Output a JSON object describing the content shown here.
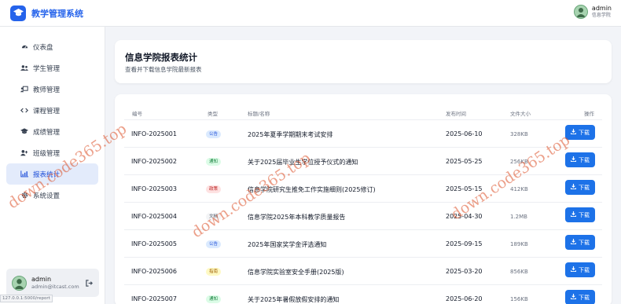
{
  "app": {
    "title": "教学管理系统"
  },
  "top_user": {
    "name": "admin",
    "role": "信息学院"
  },
  "sidebar": {
    "items": [
      {
        "label": "仪表盘",
        "icon": "dashboard-icon"
      },
      {
        "label": "学生管理",
        "icon": "users-icon"
      },
      {
        "label": "教师管理",
        "icon": "teacher-icon"
      },
      {
        "label": "课程管理",
        "icon": "code-icon"
      },
      {
        "label": "成绩管理",
        "icon": "grade-icon"
      },
      {
        "label": "班级管理",
        "icon": "class-icon"
      },
      {
        "label": "报表统计",
        "icon": "chart-icon",
        "active": true
      },
      {
        "label": "系统设置",
        "icon": "gear-icon"
      }
    ],
    "user": {
      "name": "admin",
      "email": "admin@itcast.com"
    }
  },
  "status_url": "127.0.0.1:5000/report",
  "header": {
    "title": "信息学院报表统计",
    "subtitle": "查看并下载信息学院最新报表"
  },
  "table": {
    "columns": [
      "编号",
      "类型",
      "标题/名称",
      "发布时间",
      "文件大小",
      "操作"
    ],
    "download_label": "下载",
    "rows": [
      {
        "id": "INFO-2025001",
        "type": "公告",
        "title": "2025年夏季学期期末考试安排",
        "date": "2025-06-10",
        "size": "328KB"
      },
      {
        "id": "INFO-2025002",
        "type": "通知",
        "title": "关于2025届毕业生学位授予仪式的通知",
        "date": "2025-05-25",
        "size": "256KB"
      },
      {
        "id": "INFO-2025003",
        "type": "政策",
        "title": "信息学院研究生推免工作实施细则(2025修订)",
        "date": "2025-05-15",
        "size": "412KB"
      },
      {
        "id": "INFO-2025004",
        "type": "文档",
        "title": "信息学院2025年本科教学质量报告",
        "date": "2025-04-30",
        "size": "1.2MB"
      },
      {
        "id": "INFO-2025005",
        "type": "公告",
        "title": "2025年国家奖学金评选通知",
        "date": "2025-09-15",
        "size": "189KB"
      },
      {
        "id": "INFO-2025006",
        "type": "指南",
        "title": "信息学院实验室安全手册(2025版)",
        "date": "2025-03-20",
        "size": "856KB"
      },
      {
        "id": "INFO-2025007",
        "type": "通知",
        "title": "关于2025年暑假放假安排的通知",
        "date": "2025-06-20",
        "size": "156KB"
      }
    ]
  },
  "badge_colors": {
    "公告": {
      "bg": "#dbeafe",
      "fg": "#1d4ed8"
    },
    "通知": {
      "bg": "#dcfce7",
      "fg": "#15803d"
    },
    "政策": {
      "bg": "#fee2e2",
      "fg": "#b91c1c"
    },
    "文档": {
      "bg": "#f3f4f6",
      "fg": "#4b5563"
    },
    "指南": {
      "bg": "#fef9c3",
      "fg": "#a16207"
    }
  },
  "watermark": "down.code365.top",
  "accent": "#2563eb"
}
